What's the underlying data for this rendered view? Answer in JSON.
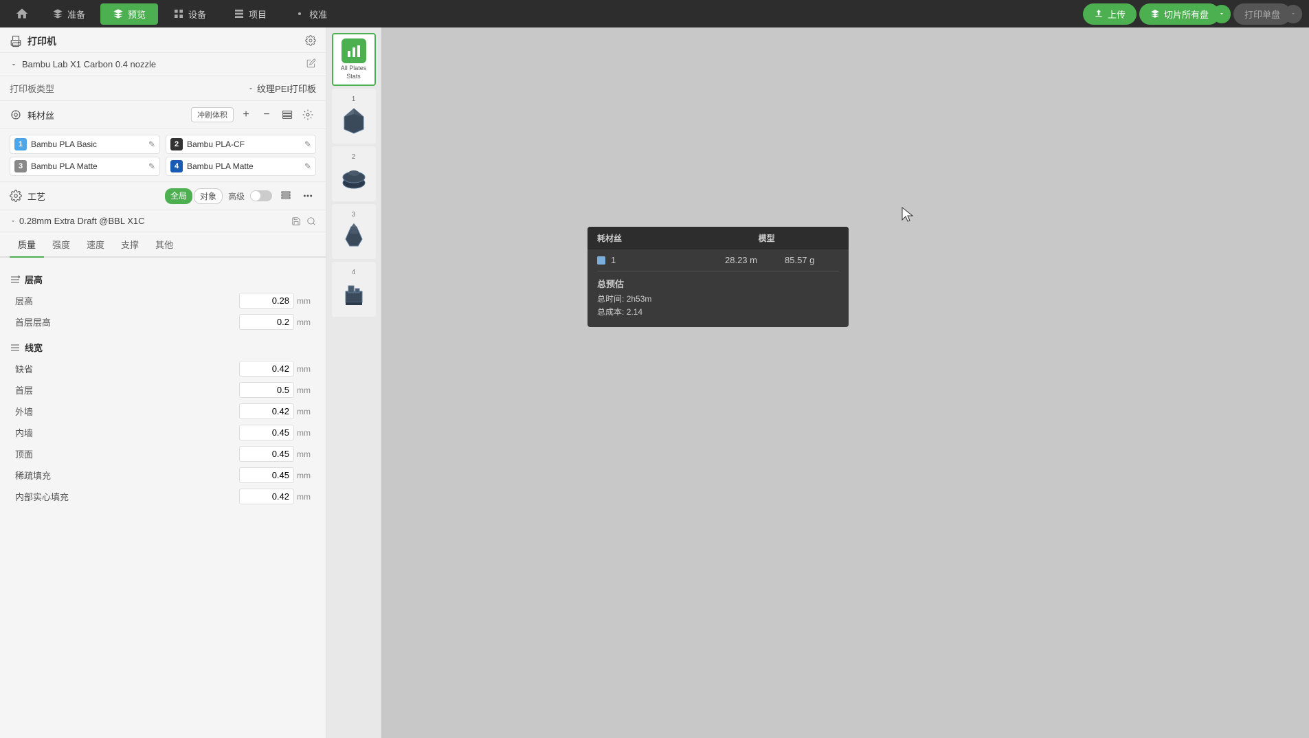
{
  "nav": {
    "home_icon": "⌂",
    "items": [
      {
        "id": "prepare",
        "label": "准备",
        "icon": "⬡",
        "active": false
      },
      {
        "id": "preview",
        "label": "预览",
        "icon": "◈",
        "active": true
      },
      {
        "id": "device",
        "label": "设备",
        "icon": "⊞",
        "active": false
      },
      {
        "id": "project",
        "label": "项目",
        "icon": "▦",
        "active": false
      },
      {
        "id": "calibrate",
        "label": "校准",
        "icon": "⚙",
        "active": false
      }
    ],
    "btn_upload": "上传",
    "btn_slice_all": "切片所有盘",
    "btn_print": "打印单盘",
    "upload_icon": "↑",
    "slice_icon": "◈",
    "print_icon": "▷"
  },
  "left_panel": {
    "printer_section_label": "打印机",
    "printer_section_icon": "printer",
    "printer_name": "Bambu Lab X1 Carbon 0.4 nozzle",
    "printer_type_label": "打印板类型",
    "printer_type_value": "纹理PEI打印板",
    "filament_section_label": "耗材丝",
    "flush_vol_btn": "冲刷体积",
    "filaments": [
      {
        "num": 1,
        "name": "Bambu PLA Basic",
        "color": "#4da6e8"
      },
      {
        "num": 2,
        "name": "Bambu PLA-CF",
        "color": "#333333"
      },
      {
        "num": 3,
        "name": "Bambu PLA Matte",
        "color": "#888888"
      },
      {
        "num": 4,
        "name": "Bambu PLA Matte",
        "color": "#1a5cb5"
      }
    ],
    "process_section_label": "工艺",
    "tag_global": "全局",
    "tag_object": "对象",
    "advanced_label": "高级",
    "process_profile": "0.28mm Extra Draft @BBL X1C",
    "tabs": [
      "质量",
      "强度",
      "速度",
      "支撑",
      "其他"
    ],
    "active_tab": "质量",
    "layer_height_group": "层高",
    "settings": [
      {
        "id": "layer_height",
        "label": "层高",
        "value": "0.28",
        "unit": "mm"
      },
      {
        "id": "first_layer_height",
        "label": "首层层高",
        "value": "0.2",
        "unit": "mm"
      }
    ],
    "line_width_group": "线宽",
    "line_settings": [
      {
        "id": "default",
        "label": "缺省",
        "value": "0.42",
        "unit": "mm"
      },
      {
        "id": "first_layer",
        "label": "首层",
        "value": "0.5",
        "unit": "mm"
      },
      {
        "id": "outer_wall",
        "label": "外墙",
        "value": "0.42",
        "unit": "mm"
      },
      {
        "id": "inner_wall",
        "label": "内墙",
        "value": "0.45",
        "unit": "mm"
      },
      {
        "id": "top_surface",
        "label": "顶面",
        "value": "0.45",
        "unit": "mm"
      },
      {
        "id": "sparse_infill",
        "label": "稀疏填充",
        "value": "0.45",
        "unit": "mm"
      },
      {
        "id": "inner_solid",
        "label": "内部实心填充",
        "value": "0.42",
        "unit": "mm"
      }
    ]
  },
  "plates": {
    "stats": {
      "label_line1": "All Plates",
      "label_line2": "Stats",
      "active": true
    },
    "items": [
      {
        "num": 1,
        "has_model": true
      },
      {
        "num": 2,
        "has_model": true
      },
      {
        "num": 3,
        "has_model": true
      },
      {
        "num": 4,
        "has_model": true
      }
    ]
  },
  "stats_popup": {
    "col1": "耗材丝",
    "col2": "模型",
    "filament_num": "1",
    "filament_length": "28.23 m",
    "filament_weight": "85.57 g",
    "total_label": "总预估",
    "total_time_label": "总时间:",
    "total_time": "2h53m",
    "total_cost_label": "总成本:",
    "total_cost": "2.14"
  }
}
